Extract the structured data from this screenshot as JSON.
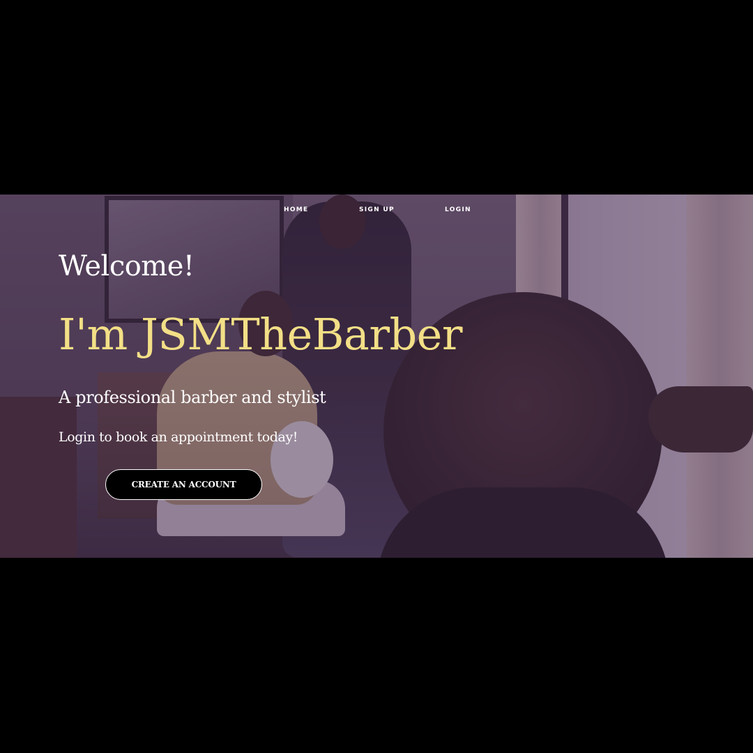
{
  "nav": {
    "items": [
      {
        "label": "HOME"
      },
      {
        "label": "SIGN UP"
      },
      {
        "label": "LOGIN"
      }
    ]
  },
  "hero": {
    "welcome": "Welcome!",
    "title": "I'm JSMTheBarber",
    "subtitle": "A professional barber and stylist",
    "tagline": "Login to book an appointment today!",
    "cta_label": "CREATE AN ACCOUNT",
    "background_image": "barbershop-photo",
    "overlay_color": "#3c2346",
    "title_color": "#f3df86",
    "text_color": "#ffffff",
    "button_color": "#000000"
  }
}
